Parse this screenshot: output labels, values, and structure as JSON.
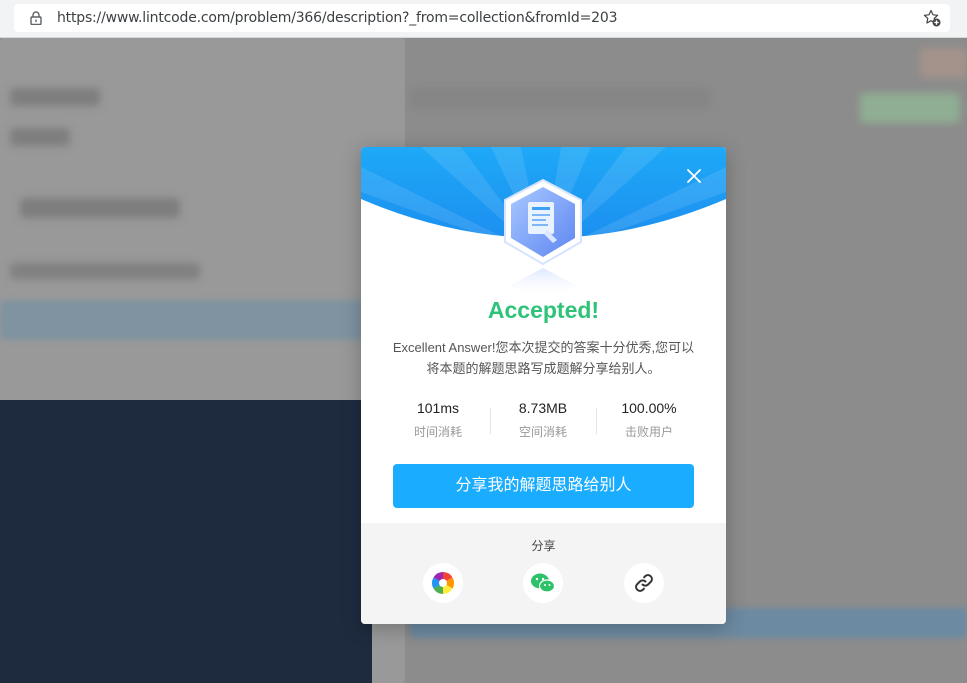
{
  "browser": {
    "url": "https://www.lintcode.com/problem/366/description?_from=collection&fromId=203"
  },
  "modal": {
    "title": "Accepted!",
    "description": "Excellent Answer!您本次提交的答案十分优秀,您可以将本题的解题思路写成题解分享给别人。",
    "stats": [
      {
        "value": "101ms",
        "label": "时间消耗"
      },
      {
        "value": "8.73MB",
        "label": "空间消耗"
      },
      {
        "value": "100.00%",
        "label": "击败用户"
      }
    ],
    "share_button": "分享我的解题思路给别人",
    "share_label": "分享",
    "share_icons": [
      "pinwheel-icon",
      "wechat-icon",
      "link-icon"
    ],
    "colors": {
      "accent": "#1aacff",
      "accepted": "#2fc37a"
    }
  }
}
